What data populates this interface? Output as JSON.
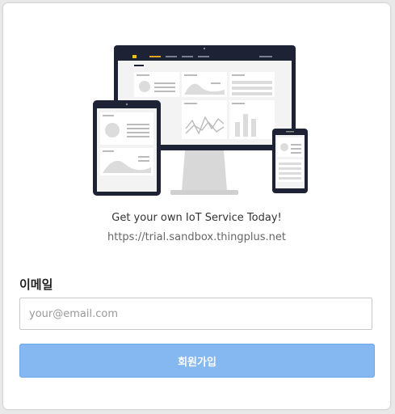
{
  "hero": {
    "tagline": "Get your own IoT Service Today!",
    "url": "https://trial.sandbox.thingplus.net"
  },
  "form": {
    "email_label": "이메일",
    "email_placeholder": "your@email.com",
    "email_value": "",
    "signup_label": "회원가입"
  },
  "colors": {
    "button_bg": "#85b7f0",
    "device_frame": "#1e2235",
    "logo_accent": "#f0c020"
  }
}
